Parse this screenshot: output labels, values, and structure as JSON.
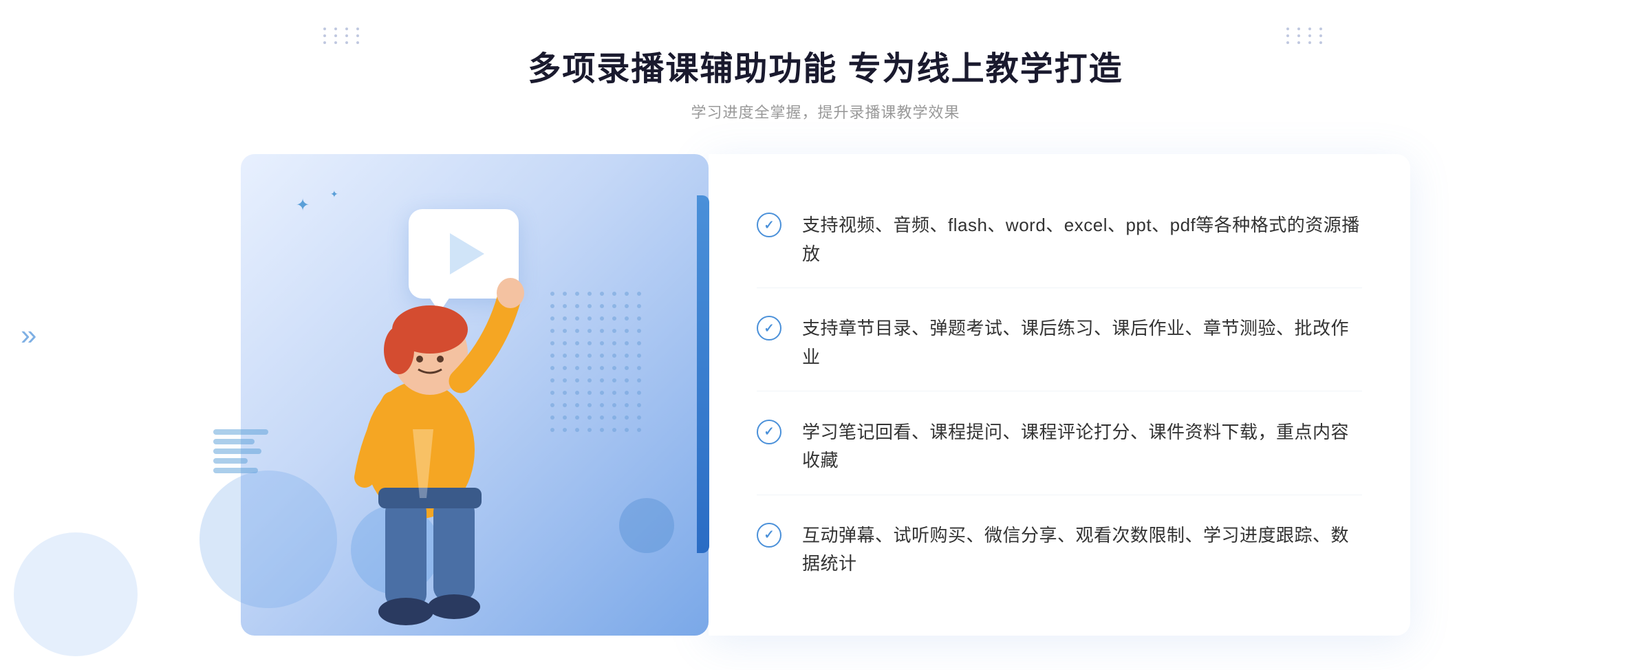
{
  "header": {
    "title": "多项录播课辅助功能 专为线上教学打造",
    "subtitle": "学习进度全掌握，提升录播课教学效果"
  },
  "features": [
    {
      "id": 1,
      "text": "支持视频、音频、flash、word、excel、ppt、pdf等各种格式的资源播放"
    },
    {
      "id": 2,
      "text": "支持章节目录、弹题考试、课后练习、课后作业、章节测验、批改作业"
    },
    {
      "id": 3,
      "text": "学习笔记回看、课程提问、课程评论打分、课件资料下载，重点内容收藏"
    },
    {
      "id": 4,
      "text": "互动弹幕、试听购买、微信分享、观看次数限制、学习进度跟踪、数据统计"
    }
  ],
  "decorations": {
    "left_arrow": "»",
    "check_symbol": "✓"
  }
}
